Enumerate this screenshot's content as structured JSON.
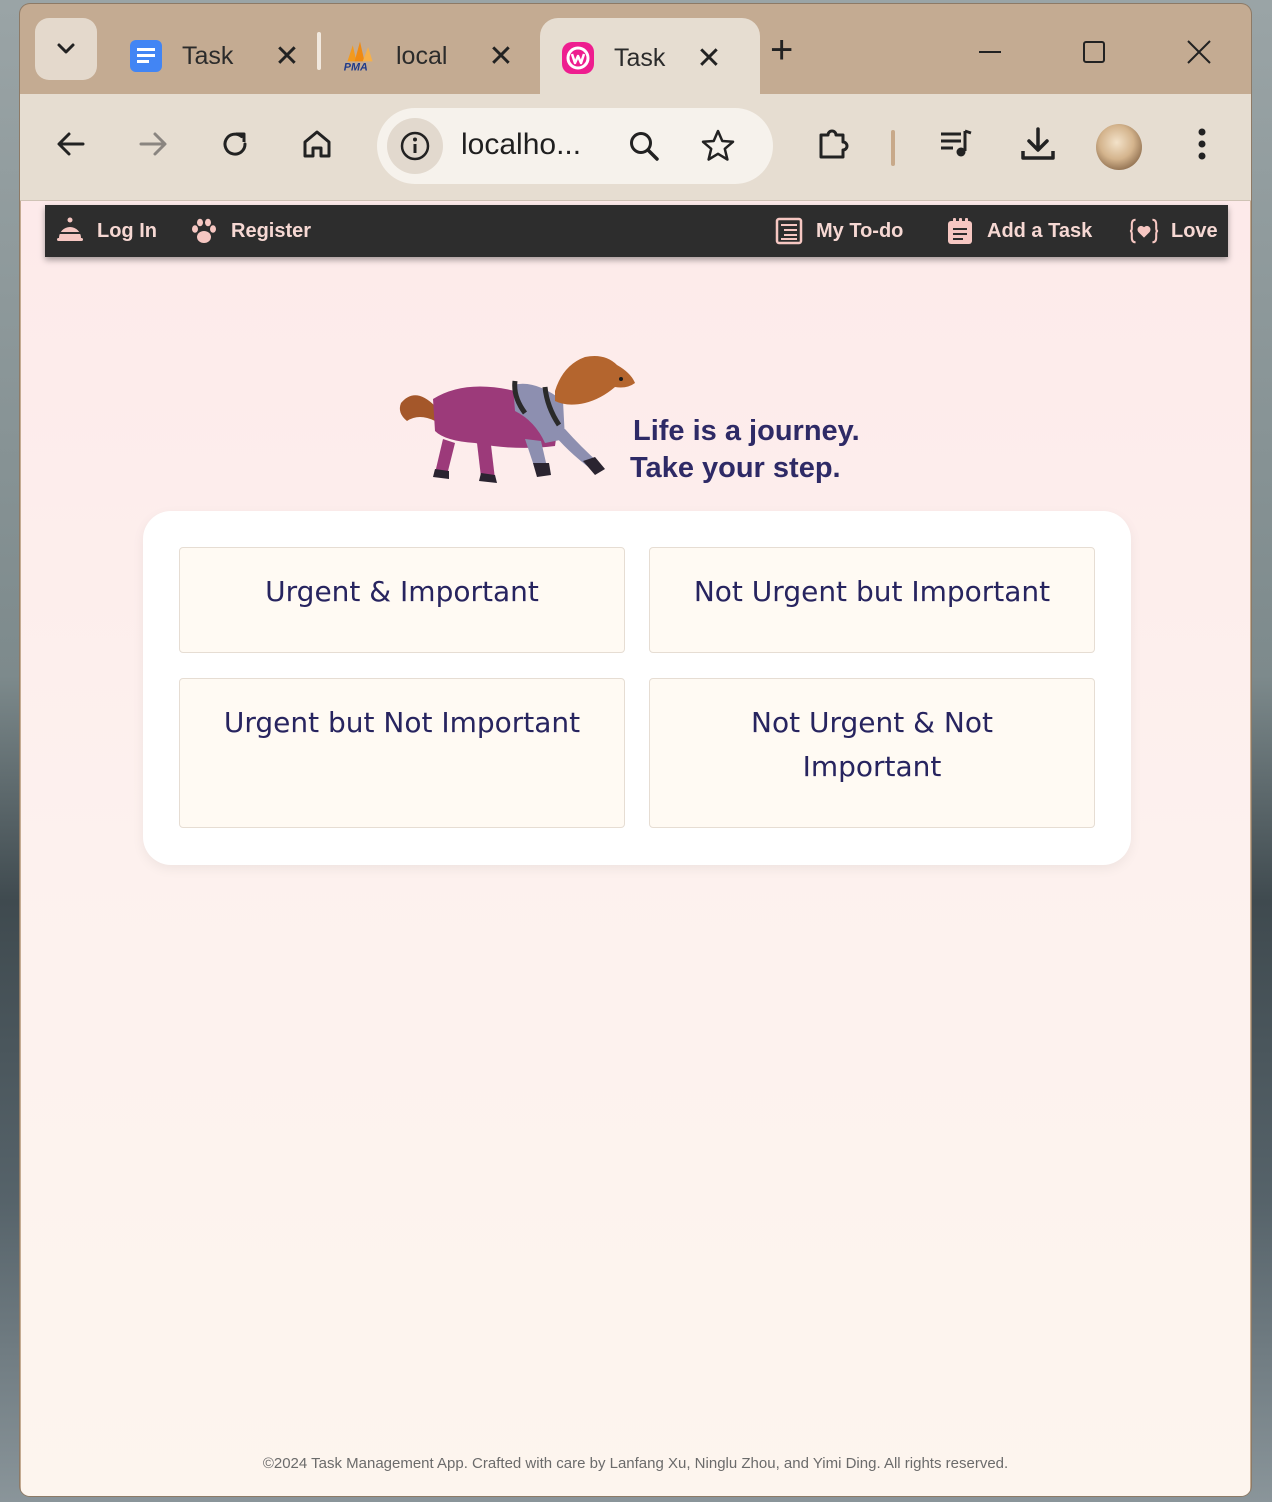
{
  "browser": {
    "tabs": [
      {
        "title": "Task",
        "icon": "docs-icon",
        "active": false
      },
      {
        "title": "local",
        "icon": "phpmyadmin-icon",
        "active": false
      },
      {
        "title": "Task",
        "icon": "wamp-icon",
        "active": true
      }
    ],
    "url": "localho...",
    "favicon_colors": {
      "docs": "#4285f4",
      "wamp": "#ee1d8f",
      "pma": "#f08a12"
    }
  },
  "nav": {
    "left": [
      {
        "label": "Log In",
        "icon": "bell-icon"
      },
      {
        "label": "Register",
        "icon": "paw-icon"
      }
    ],
    "right": [
      {
        "label": "My To-do",
        "icon": "notebook-icon"
      },
      {
        "label": "Add a Task",
        "icon": "notepad-icon"
      },
      {
        "label": "Love",
        "icon": "heart-braces-icon"
      }
    ],
    "colors": {
      "bar": "#2d2d2d",
      "text": "#f6d8d3"
    }
  },
  "hero": {
    "line1": "Life is a journey.",
    "line2": "Take your step."
  },
  "matrix": {
    "quadrants": [
      {
        "label": "Urgent & Important"
      },
      {
        "label": "Not Urgent but Important"
      },
      {
        "label": "Urgent but Not Important"
      },
      {
        "label": "Not Urgent & Not Important"
      }
    ],
    "colors": {
      "text": "#27245f",
      "card": "#fffaf3"
    }
  },
  "footer": {
    "text": "©2024 Task Management App. Crafted with care by Lanfang Xu, Ninglu Zhou, and Yimi Ding. All rights reserved."
  }
}
